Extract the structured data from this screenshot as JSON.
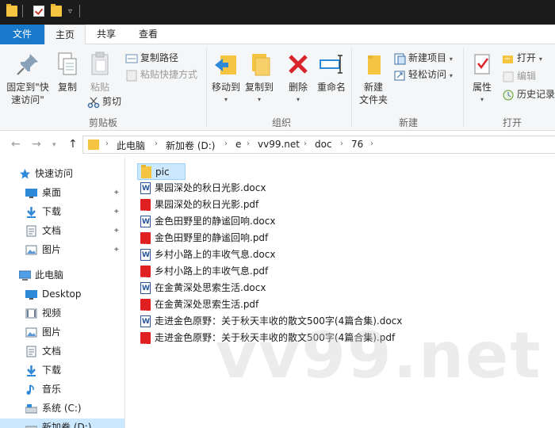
{
  "titlebar": {
    "icons": [
      "folder-icon",
      "properties-check-icon",
      "new-folder-icon",
      "dropdown-arrow-icon"
    ]
  },
  "tabs": {
    "file": "文件",
    "home": "主页",
    "share": "共享",
    "view": "查看"
  },
  "ribbon": {
    "clipboard": {
      "pin_line1": "固定到\"快",
      "pin_line2": "速访问\"",
      "copy": "复制",
      "paste": "粘贴",
      "copy_path": "复制路径",
      "paste_shortcut": "粘贴快捷方式",
      "cut": "剪切",
      "group_label": "剪贴板"
    },
    "organize": {
      "move_to": "移动到",
      "copy_to": "复制到",
      "delete": "删除",
      "rename": "重命名",
      "group_label": "组织"
    },
    "new": {
      "new_folder_line1": "新建",
      "new_folder_line2": "文件夹",
      "new_item": "新建项目",
      "easy_access": "轻松访问",
      "group_label": "新建"
    },
    "open": {
      "properties": "属性",
      "open": "打开",
      "edit": "编辑",
      "history": "历史记录",
      "group_label": "打开"
    }
  },
  "address": {
    "crumbs": [
      "此电脑",
      "新加卷 (D:)",
      "e",
      "vv99.net",
      "doc",
      "76"
    ]
  },
  "navpane": {
    "items": [
      {
        "label": "快速访问",
        "icon": "star-icon",
        "pinned": false
      },
      {
        "label": "桌面",
        "icon": "desktop-icon",
        "pinned": true
      },
      {
        "label": "下载",
        "icon": "download-icon",
        "pinned": true
      },
      {
        "label": "文档",
        "icon": "documents-icon",
        "pinned": true
      },
      {
        "label": "图片",
        "icon": "pictures-icon",
        "pinned": true
      },
      {
        "label": "此电脑",
        "icon": "this-pc-icon",
        "pinned": false
      },
      {
        "label": "Desktop",
        "icon": "desktop-icon",
        "pinned": false
      },
      {
        "label": "视频",
        "icon": "videos-icon",
        "pinned": false
      },
      {
        "label": "图片",
        "icon": "pictures-icon",
        "pinned": false
      },
      {
        "label": "文档",
        "icon": "documents-icon",
        "pinned": false
      },
      {
        "label": "下载",
        "icon": "download-icon",
        "pinned": false
      },
      {
        "label": "音乐",
        "icon": "music-icon",
        "pinned": false
      },
      {
        "label": "系统 (C:)",
        "icon": "drive-icon",
        "pinned": false
      },
      {
        "label": "新加卷 (D:)",
        "icon": "drive-icon",
        "pinned": false
      }
    ]
  },
  "files": [
    {
      "name": "pic",
      "type": "folder",
      "selected": true
    },
    {
      "name": "果园深处的秋日光影.docx",
      "type": "docx"
    },
    {
      "name": "果园深处的秋日光影.pdf",
      "type": "pdf"
    },
    {
      "name": "金色田野里的静谧回响.docx",
      "type": "docx"
    },
    {
      "name": "金色田野里的静谧回响.pdf",
      "type": "pdf"
    },
    {
      "name": "乡村小路上的丰收气息.docx",
      "type": "docx"
    },
    {
      "name": "乡村小路上的丰收气息.pdf",
      "type": "pdf"
    },
    {
      "name": "在金黄深处思索生活.docx",
      "type": "docx"
    },
    {
      "name": "在金黄深处思索生活.pdf",
      "type": "pdf"
    },
    {
      "name": "走进金色原野：关于秋天丰收的散文500字(4篇合集).docx",
      "type": "docx"
    },
    {
      "name": "走进金色原野：关于秋天丰收的散文500字(4篇合集).pdf",
      "type": "pdf"
    }
  ],
  "watermark": "vv99.net",
  "colors": {
    "accent": "#1979ca",
    "selection": "#cce8ff",
    "folder": "#f5c542",
    "pdf": "#e02020",
    "word": "#2b579a",
    "titlebar": "#1b1b1b"
  }
}
